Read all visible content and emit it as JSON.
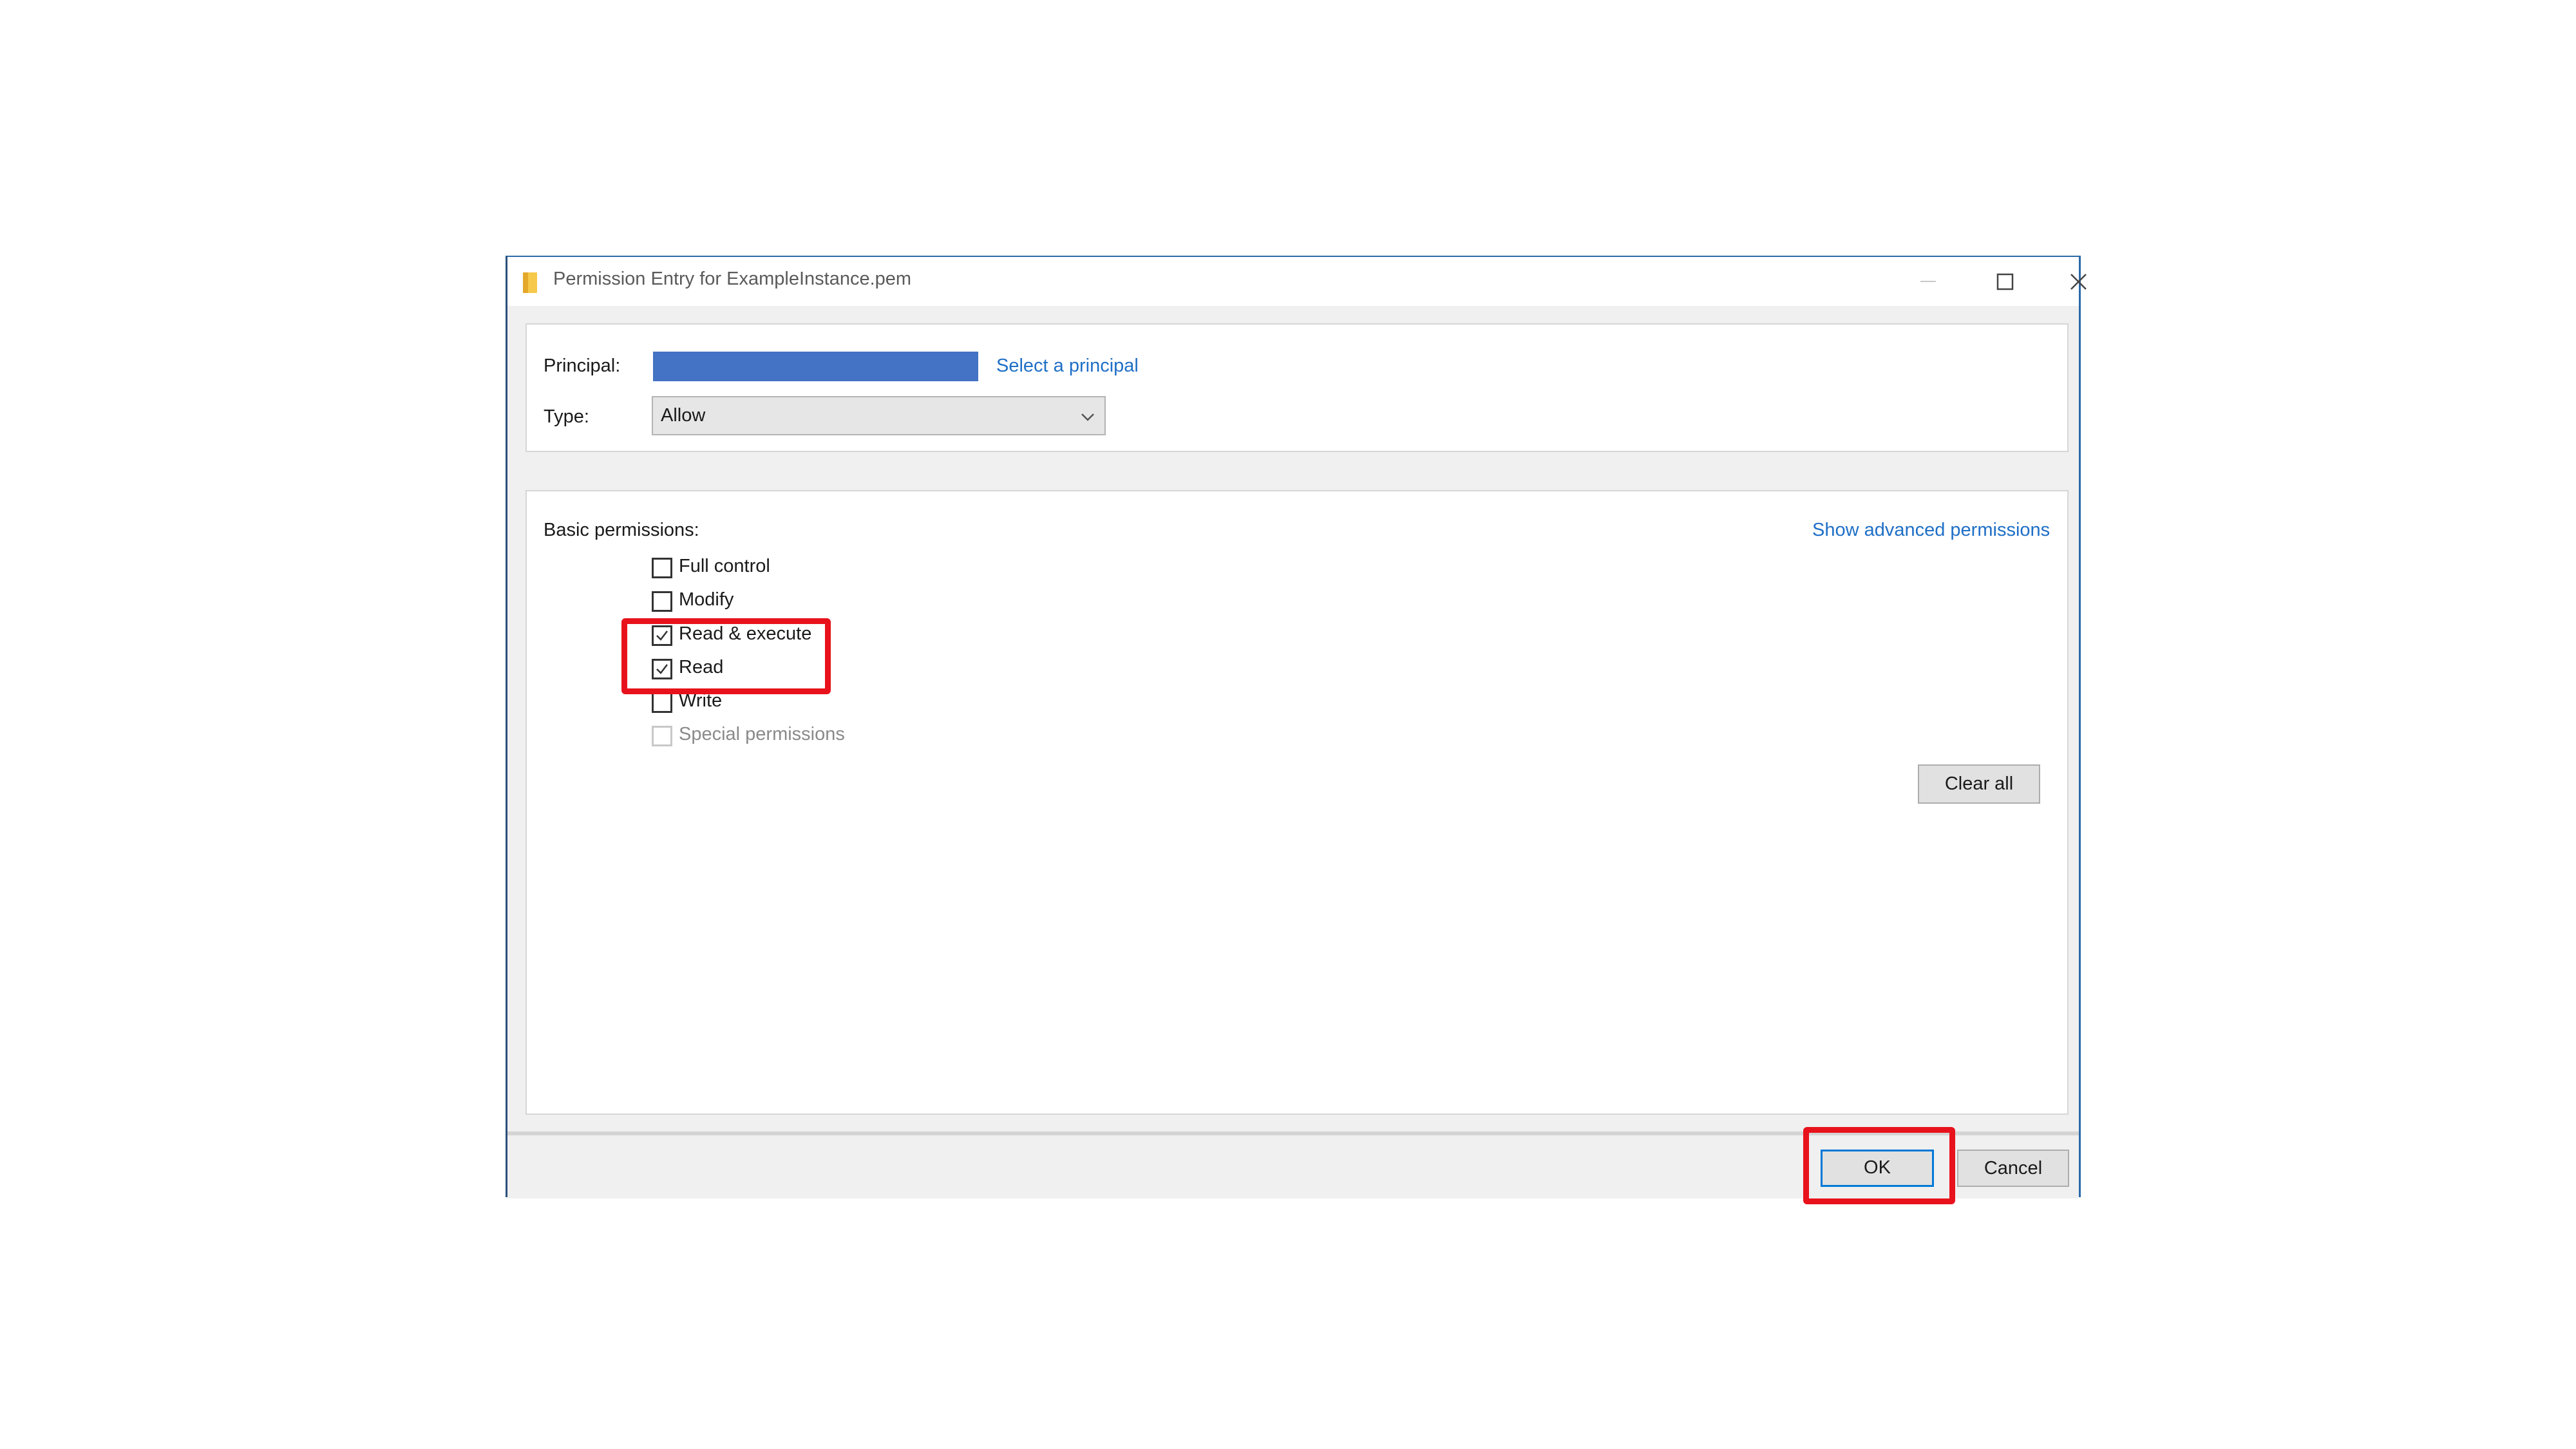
{
  "window": {
    "title": "Permission Entry for ExampleInstance.pem"
  },
  "principal": {
    "label": "Principal:",
    "select_link": "Select a principal"
  },
  "type": {
    "label": "Type:",
    "value": "Allow"
  },
  "permissions": {
    "heading": "Basic permissions:",
    "advanced_link": "Show advanced permissions",
    "items": [
      {
        "label": "Full control",
        "checked": false,
        "enabled": true
      },
      {
        "label": "Modify",
        "checked": false,
        "enabled": true
      },
      {
        "label": "Read & execute",
        "checked": true,
        "enabled": true
      },
      {
        "label": "Read",
        "checked": true,
        "enabled": true
      },
      {
        "label": "Write",
        "checked": false,
        "enabled": true
      },
      {
        "label": "Special permissions",
        "checked": false,
        "enabled": false
      }
    ],
    "clear_all_label": "Clear all"
  },
  "footer": {
    "ok_label": "OK",
    "cancel_label": "Cancel"
  },
  "colors": {
    "highlight": "#e8121c",
    "link": "#1f6fc6",
    "principal_bar": "#4472c4",
    "ok_border": "#0078d7"
  },
  "icons": [
    "folder-icon",
    "minimize-icon",
    "maximize-icon",
    "close-icon",
    "chevron-down-icon",
    "checkmark-icon"
  ]
}
